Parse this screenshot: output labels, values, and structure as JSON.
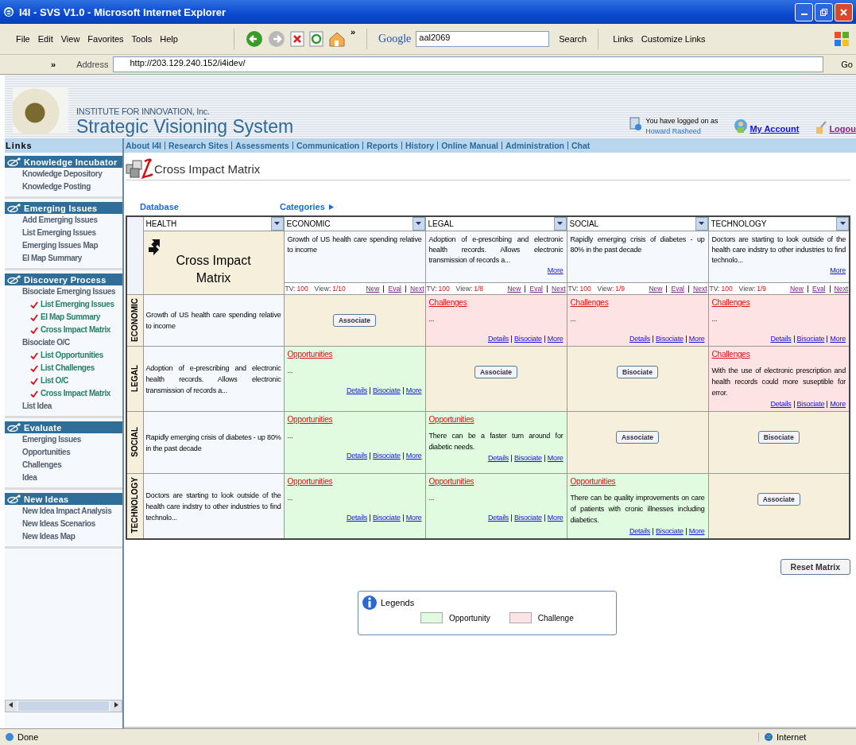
{
  "window": {
    "title": "I4I - SVS V1.0 - Microsoft Internet Explorer"
  },
  "menu": [
    "File",
    "Edit",
    "View",
    "Favorites",
    "Tools",
    "Help"
  ],
  "toolbar": {
    "google": "Google",
    "query": "aal2069",
    "search": "Search",
    "links": "Links",
    "customize": "Customize Links",
    "more": "»"
  },
  "address": {
    "more": "»",
    "label": "Address",
    "url": "http://203.129.240.152/i4idev/",
    "go": "Go"
  },
  "header": {
    "org": "INSTITUTE FOR INNOVATION, Inc.",
    "title": "Strategic Visioning System",
    "logged": "You have logged on as",
    "user": "Howard Rasheed",
    "account": "My Account",
    "logout": "Logou"
  },
  "nav": [
    "About I4I",
    "Research Sites",
    "Assessments",
    "Communication",
    "Reports",
    "History",
    "Online Manual",
    "Administration",
    "Chat"
  ],
  "sidebar": {
    "title": "Links",
    "sections": [
      {
        "title": "Knowledge Incubator",
        "items": [
          {
            "label": "Knowledge Depository"
          },
          {
            "label": "Knowledge Posting"
          }
        ]
      },
      {
        "title": "Emerging Issues",
        "items": [
          {
            "label": "Add Emerging Issues"
          },
          {
            "label": "List Emerging Issues"
          },
          {
            "label": "Emerging Issues Map"
          },
          {
            "label": "EI Map Summary"
          }
        ]
      },
      {
        "title": "Discovery Process",
        "items": [
          {
            "label": "Bisociate Emerging Issues",
            "children": [
              {
                "label": "List Emerging Issues",
                "checked": true
              },
              {
                "label": "EI Map Summary",
                "checked": true
              },
              {
                "label": "Cross Impact Matrix",
                "checked": true
              }
            ]
          },
          {
            "label": "Bisociate O/C",
            "children": [
              {
                "label": "List Opportunities",
                "checked": true
              },
              {
                "label": "List Challenges",
                "checked": true
              },
              {
                "label": "List O/C",
                "checked": true
              },
              {
                "label": "Cross Impact Matrix",
                "checked": true
              }
            ]
          },
          {
            "label": "List Idea"
          }
        ]
      },
      {
        "title": "Evaluate",
        "items": [
          {
            "label": "Emerging Issues"
          },
          {
            "label": "Opportunities"
          },
          {
            "label": "Challenges"
          },
          {
            "label": "Idea"
          }
        ]
      },
      {
        "title": "New Ideas",
        "items": [
          {
            "label": "New Idea Impact Analysis"
          },
          {
            "label": "New Ideas Scenarios"
          },
          {
            "label": "New Ideas Map"
          }
        ]
      }
    ]
  },
  "page_title": "Cross Impact Matrix",
  "database_label": "Database",
  "categories_label": "Categories",
  "matrix": {
    "corner_select": "HEALTH",
    "corner_title": "Cross Impact Matrix",
    "columns": [
      {
        "select": "ECONOMIC",
        "text": "Growth of US health care spending relative to income",
        "tv_label": "TV:",
        "tv": "100",
        "view_label": "View:",
        "view": "1/10",
        "links": [
          "New",
          "Eval",
          "Next"
        ]
      },
      {
        "select": "LEGAL",
        "text": "Adoption of e-prescribing and electronic health records. Allows electronic transmission of records a...",
        "more": "More",
        "tv_label": "TV:",
        "tv": "100",
        "view_label": "View:",
        "view": "1/8",
        "links": [
          "New",
          "Eval",
          "Next"
        ]
      },
      {
        "select": "SOCIAL",
        "text": "Rapidly emerging crisis of diabetes - up 80% in the past decade",
        "tv_label": "TV:",
        "tv": "100",
        "view_label": "View:",
        "view": "1/9",
        "links": [
          "New",
          "Eval",
          "Next"
        ]
      },
      {
        "select": "TECHNOLOGY",
        "text": "Doctors are starting to look outside of the health care indstry to other industries to find technolo...",
        "more": "More",
        "tv_label": "TV:",
        "tv": "100",
        "view_label": "View:",
        "view": "1/9",
        "links": [
          "New",
          "Eval",
          "Next"
        ]
      }
    ],
    "rows": [
      {
        "label": "ECONOMIC",
        "text": "Growth of US health care spending relative to income",
        "cells": [
          {
            "kind": "button",
            "button": "Associate"
          },
          {
            "kind": "challenge",
            "heading": "Challenges",
            "text": "...",
            "links": [
              "Details",
              "Bisociate",
              "More"
            ]
          },
          {
            "kind": "challenge",
            "heading": "Challenges",
            "text": "...",
            "links": [
              "Details",
              "Bisociate",
              "More"
            ]
          },
          {
            "kind": "challenge",
            "heading": "Challenges",
            "text": "...",
            "links": [
              "Details",
              "Bisociate",
              "More"
            ]
          }
        ]
      },
      {
        "label": "LEGAL",
        "text": "Adoption of e-prescribing and electronic health records. Allows electronic transmission of records a...",
        "cells": [
          {
            "kind": "opportunity",
            "heading": "Opportunities",
            "text": "...",
            "links": [
              "Details",
              "Bisociate",
              "More"
            ]
          },
          {
            "kind": "button",
            "button": "Associate"
          },
          {
            "kind": "button",
            "button": "Bisociate"
          },
          {
            "kind": "challenge",
            "heading": "Challenges",
            "text": "With the use of electronic prescription and health records could more suseptible for error.",
            "links": [
              "Details",
              "Bisociate",
              "More"
            ]
          }
        ]
      },
      {
        "label": "SOCIAL",
        "text": "Rapidly emerging crisis of diabetes - up 80% in the past decade",
        "cells": [
          {
            "kind": "opportunity",
            "heading": "Opportunities",
            "text": "...",
            "links": [
              "Details",
              "Bisociate",
              "More"
            ]
          },
          {
            "kind": "opportunity",
            "heading": "Opportunities",
            "text": "There can be a faster turn around for diabetic needs.",
            "links": [
              "Details",
              "Bisociate",
              "More"
            ]
          },
          {
            "kind": "button",
            "button": "Associate"
          },
          {
            "kind": "button",
            "button": "Bisociate"
          }
        ]
      },
      {
        "label": "TECHNOLOGY",
        "text": "Doctors are starting to look outside of the health care indstry to other industries to find technolo...",
        "cells": [
          {
            "kind": "opportunity",
            "heading": "Opportunities",
            "text": "...",
            "links": [
              "Details",
              "Bisociate",
              "More"
            ]
          },
          {
            "kind": "opportunity",
            "heading": "Opportunities",
            "text": "...",
            "links": [
              "Details",
              "Bisociate",
              "More"
            ]
          },
          {
            "kind": "opportunity",
            "heading": "Opportunities",
            "text": "There can be quality improvements on care of patients with cronic illnesses including diabetics.",
            "links": [
              "Details",
              "Bisociate",
              "More"
            ]
          },
          {
            "kind": "button",
            "button": "Associate"
          }
        ]
      }
    ]
  },
  "reset_button": "Reset Matrix",
  "legend": {
    "title": "Legends",
    "items": [
      {
        "label": "Opportunity",
        "color": "#e0fbe0"
      },
      {
        "label": "Challenge",
        "color": "#fde3e3"
      }
    ]
  },
  "status": {
    "text": "Done",
    "zone": "Internet"
  }
}
